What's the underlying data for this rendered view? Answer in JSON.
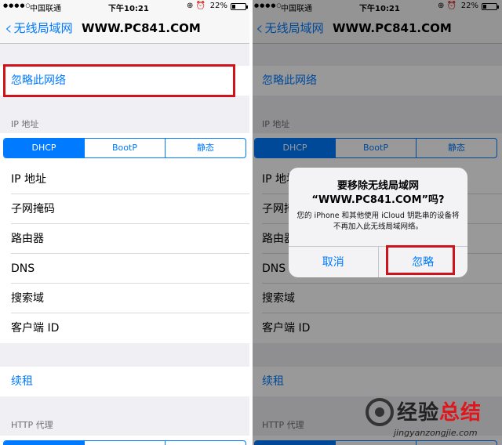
{
  "status_bar": {
    "signal": "●●●●○",
    "carrier": "中国联通",
    "time": "下午10:21",
    "icons": "⊕ ⏰",
    "battery_pct": "22%",
    "battery_level": 0.22
  },
  "nav": {
    "back_label": "无线局域网",
    "title": "WWW.PC841.COM"
  },
  "forget_label": "忽略此网络",
  "ip_section": {
    "header": "IP 地址",
    "segments": [
      "DHCP",
      "BootP",
      "静态"
    ],
    "selected": "DHCP",
    "rows": [
      "IP 地址",
      "子网掩码",
      "路由器",
      "DNS",
      "搜索域",
      "客户端 ID"
    ]
  },
  "renew_label": "续租",
  "http_proxy_header": "HTTP 代理",
  "alert": {
    "title_line1": "要移除无线局域网",
    "title_line2": "“WWW.PC841.COM”吗?",
    "message": "您的 iPhone 和其他使用 iCloud 钥匙串的设备将不再加入此无线局域网络。",
    "cancel_label": "取消",
    "forget_label": "忽略"
  },
  "watermark": {
    "title_part1": "经验",
    "title_part2": "总结",
    "url": "jingyanzongjie.com"
  },
  "colors": {
    "accent": "#007aff",
    "highlight": "#d0121b"
  }
}
